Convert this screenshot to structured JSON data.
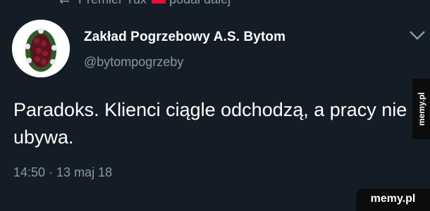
{
  "retweet_bar": {
    "name": "Premier Tux",
    "action": "podał dalej"
  },
  "tweet": {
    "display_name": "Zakład Pogrzebowy A.S. Bytom",
    "handle": "@bytompogrzeby",
    "text": "Paradoks. Klienci ciągle odchodzą, a pracy nie ubywa.",
    "timestamp": "14:50 · 13 maj 18"
  },
  "watermark": {
    "side": "memy.pl",
    "bottom": "memy.pl"
  },
  "colors": {
    "background": "#141d26",
    "secondary_text": "#8899a6",
    "primary_text": "#ffffff"
  }
}
